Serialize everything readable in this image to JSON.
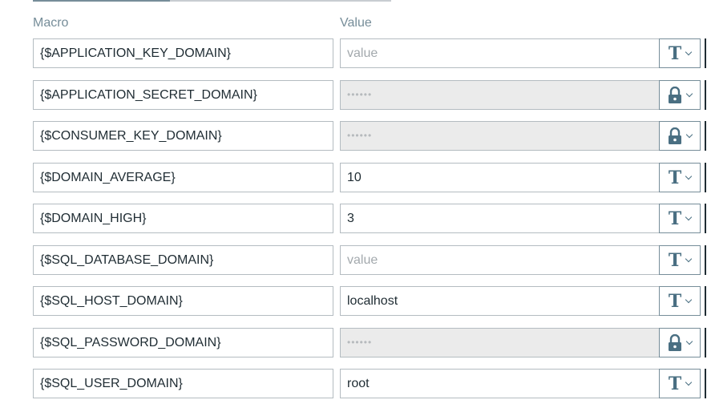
{
  "headers": {
    "macro": "Macro",
    "value": "Value"
  },
  "rows": [
    {
      "macro": "{$APPLICATION_KEY_DOMAIN}",
      "value": "value",
      "type": "text",
      "placeholder": true,
      "type_icon": "text-type-icon"
    },
    {
      "macro": "{$APPLICATION_SECRET_DOMAIN}",
      "value": "••••••",
      "type": "secret",
      "placeholder": false,
      "type_icon": "lock-icon"
    },
    {
      "macro": "{$CONSUMER_KEY_DOMAIN}",
      "value": "••••••",
      "type": "secret",
      "placeholder": false,
      "type_icon": "lock-icon"
    },
    {
      "macro": "{$DOMAIN_AVERAGE}",
      "value": "10",
      "type": "text",
      "placeholder": false,
      "type_icon": "text-type-icon"
    },
    {
      "macro": "{$DOMAIN_HIGH}",
      "value": "3",
      "type": "text",
      "placeholder": false,
      "type_icon": "text-type-icon"
    },
    {
      "macro": "{$SQL_DATABASE_DOMAIN}",
      "value": "value",
      "type": "text",
      "placeholder": true,
      "type_icon": "text-type-icon"
    },
    {
      "macro": "{$SQL_HOST_DOMAIN}",
      "value": "localhost",
      "type": "text",
      "placeholder": false,
      "type_icon": "text-type-icon"
    },
    {
      "macro": "{$SQL_PASSWORD_DOMAIN}",
      "value": "••••••",
      "type": "secret",
      "placeholder": false,
      "type_icon": "lock-icon"
    },
    {
      "macro": "{$SQL_USER_DOMAIN}",
      "value": "root",
      "type": "text",
      "placeholder": false,
      "type_icon": "text-type-icon"
    }
  ],
  "colors": {
    "accent": "#4a6f82",
    "border": "#b4bcc1",
    "secret_bg": "#ebebeb",
    "header_text": "#768d99"
  }
}
